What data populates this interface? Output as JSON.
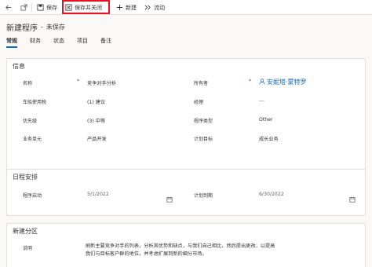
{
  "toolbar": {
    "back_icon": "back-arrow-icon",
    "popout_icon": "popout-icon",
    "save_label": "保存",
    "save_close_label": "保存并关闭",
    "new_label": "新建",
    "flow_label": "流动",
    "highlight_color": "#e81123"
  },
  "header": {
    "title": "新建程序",
    "separator": "-",
    "status": "未保存"
  },
  "tabs": [
    "常规",
    "财务",
    "状态",
    "项目",
    "备注"
  ],
  "sections": {
    "info": {
      "title": "信息",
      "name_label": "名称",
      "name_value": "竞争对手分析",
      "owner_label": "所有者",
      "owner_value": "安妮塔·蒙特罗",
      "fiscal_label": "车船使用税",
      "fiscal_value": "(1) 建议",
      "manager_label": "经理",
      "manager_value": "---",
      "priority_label": "优先级",
      "priority_value": "(3) 中等",
      "type_label": "程序类型",
      "type_value": "Other",
      "unit_label": "业务单元",
      "unit_value": "产品开发",
      "goal_label": "计划目标",
      "goal_value": "成长业务"
    },
    "schedule": {
      "title": "日程安排",
      "start_label": "程序启动",
      "start_value": "5/1/2022",
      "end_label": "计划到期",
      "end_value": "6/30/2022"
    },
    "extension": {
      "title": "新建分区",
      "desc_label": "说明",
      "desc_value": "刷新主要竞争对手的列表，分析其优势和缺点，与我们自己相比，然后提出更改，以提高我们与目标客户群的地位，并考虑扩展到新的细分市场。"
    }
  },
  "colors": {
    "accent": "#0f6cbd",
    "required": "#a4262c"
  }
}
